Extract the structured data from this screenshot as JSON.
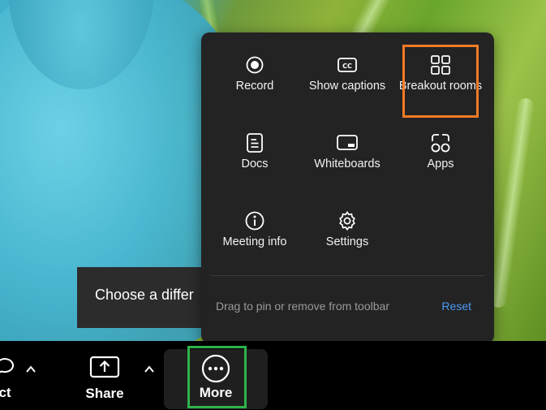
{
  "toast": {
    "text": "Choose a differ"
  },
  "menu": {
    "items": [
      {
        "label": "Record",
        "icon": "record-icon"
      },
      {
        "label": "Show captions",
        "icon": "captions-icon"
      },
      {
        "label": "Breakout rooms",
        "icon": "breakout-rooms-icon",
        "highlighted": true
      },
      {
        "label": "Docs",
        "icon": "docs-icon"
      },
      {
        "label": "Whiteboards",
        "icon": "whiteboard-icon"
      },
      {
        "label": "Apps",
        "icon": "apps-icon"
      },
      {
        "label": "Meeting info",
        "icon": "info-icon"
      },
      {
        "label": "Settings",
        "icon": "gear-icon"
      }
    ],
    "hint": "Drag to pin or remove from toolbar",
    "reset_label": "Reset"
  },
  "toolbar": {
    "items": [
      {
        "label": "ct",
        "icon": "chat-bubble-icon"
      },
      {
        "label": "Share",
        "icon": "share-screen-icon"
      },
      {
        "label": "More",
        "icon": "more-dots-icon",
        "active": true
      }
    ]
  },
  "colors": {
    "menu_bg": "#232323",
    "highlight_orange": "#f07a25",
    "highlight_green": "#2fb34a",
    "link_blue": "#4a9af5"
  }
}
